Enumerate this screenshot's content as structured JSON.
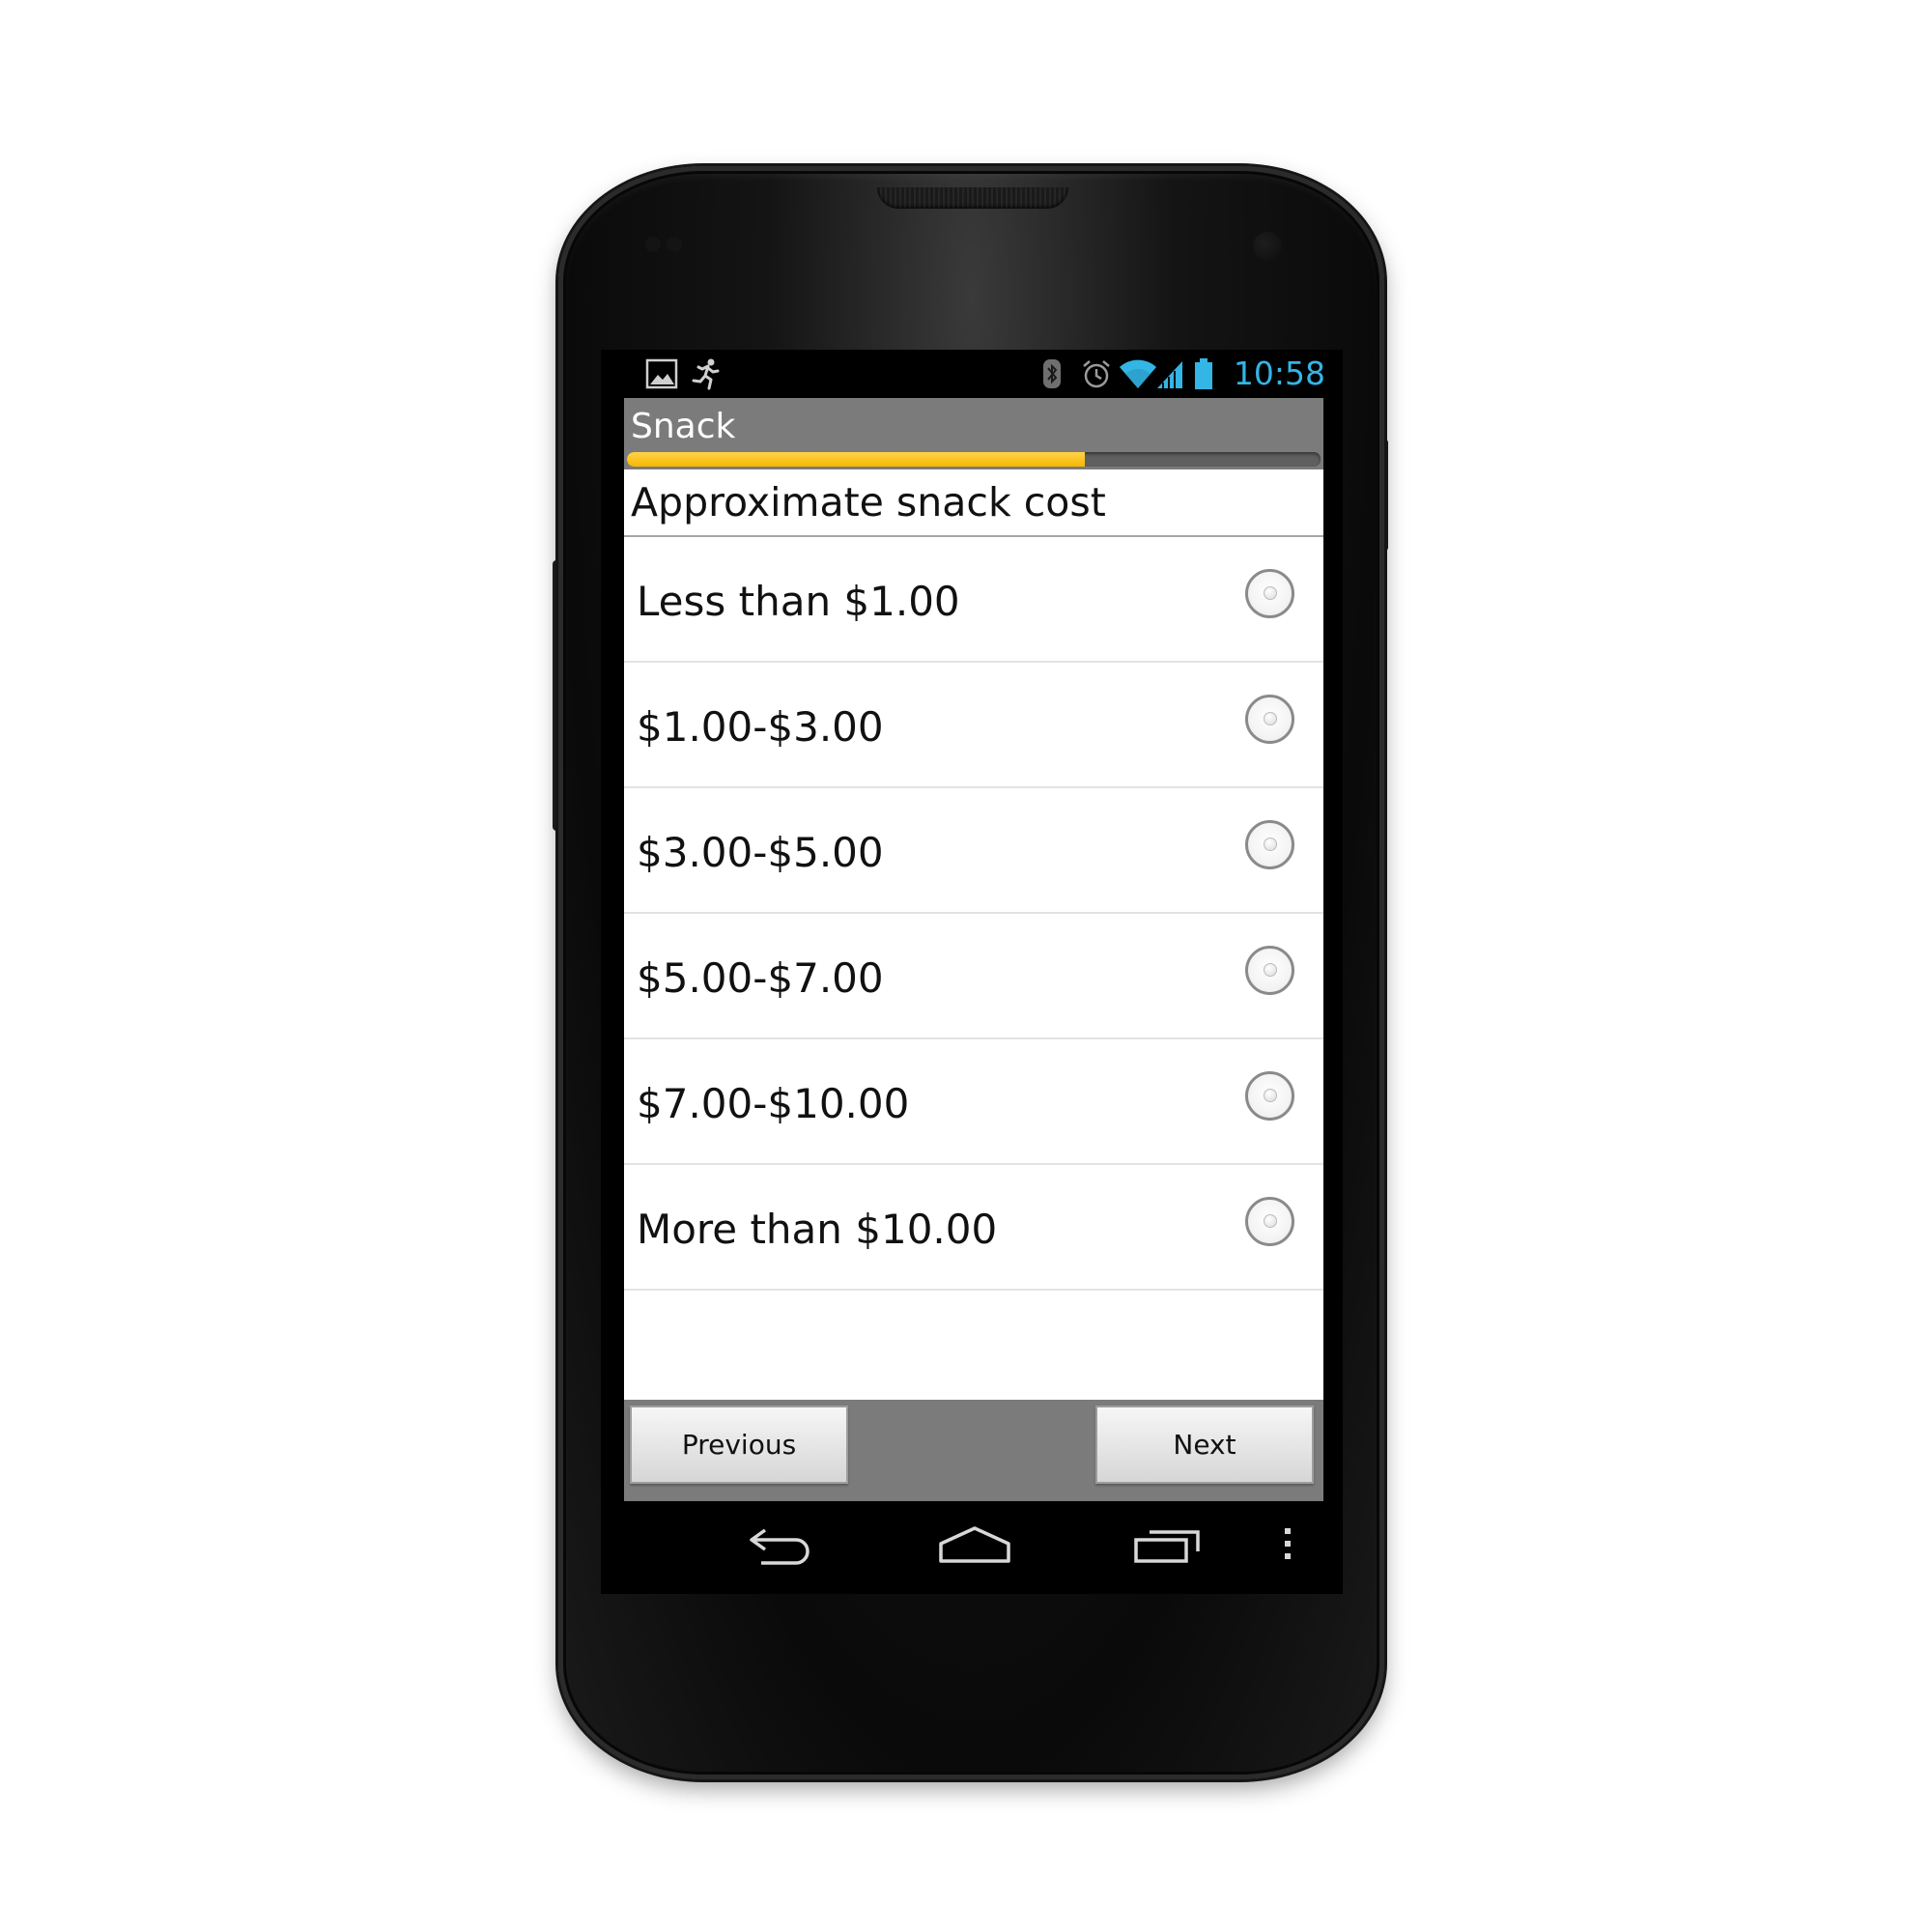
{
  "status_bar": {
    "left_icons": [
      "image-notification-icon",
      "running-man-icon"
    ],
    "right_icons": [
      "bluetooth-icon",
      "alarm-icon",
      "wifi-icon",
      "cell-signal-icon",
      "battery-icon"
    ],
    "time": "10:58",
    "time_color": "#33b5e5"
  },
  "app": {
    "title": "Snack",
    "progress_fraction": 0.66,
    "progress_color": "#f6b800",
    "question": "Approximate snack cost",
    "options": [
      {
        "label": "Less than $1.00",
        "selected": false
      },
      {
        "label": "$1.00-$3.00",
        "selected": false
      },
      {
        "label": "$3.00-$5.00",
        "selected": false
      },
      {
        "label": "$5.00-$7.00",
        "selected": false
      },
      {
        "label": "$7.00-$10.00",
        "selected": false
      },
      {
        "label": "More than $10.00",
        "selected": false
      }
    ],
    "previous_label": "Previous",
    "next_label": "Next"
  },
  "nav_bar": {
    "icons": [
      "back-icon",
      "home-icon",
      "recent-apps-icon",
      "overflow-menu-icon"
    ]
  }
}
